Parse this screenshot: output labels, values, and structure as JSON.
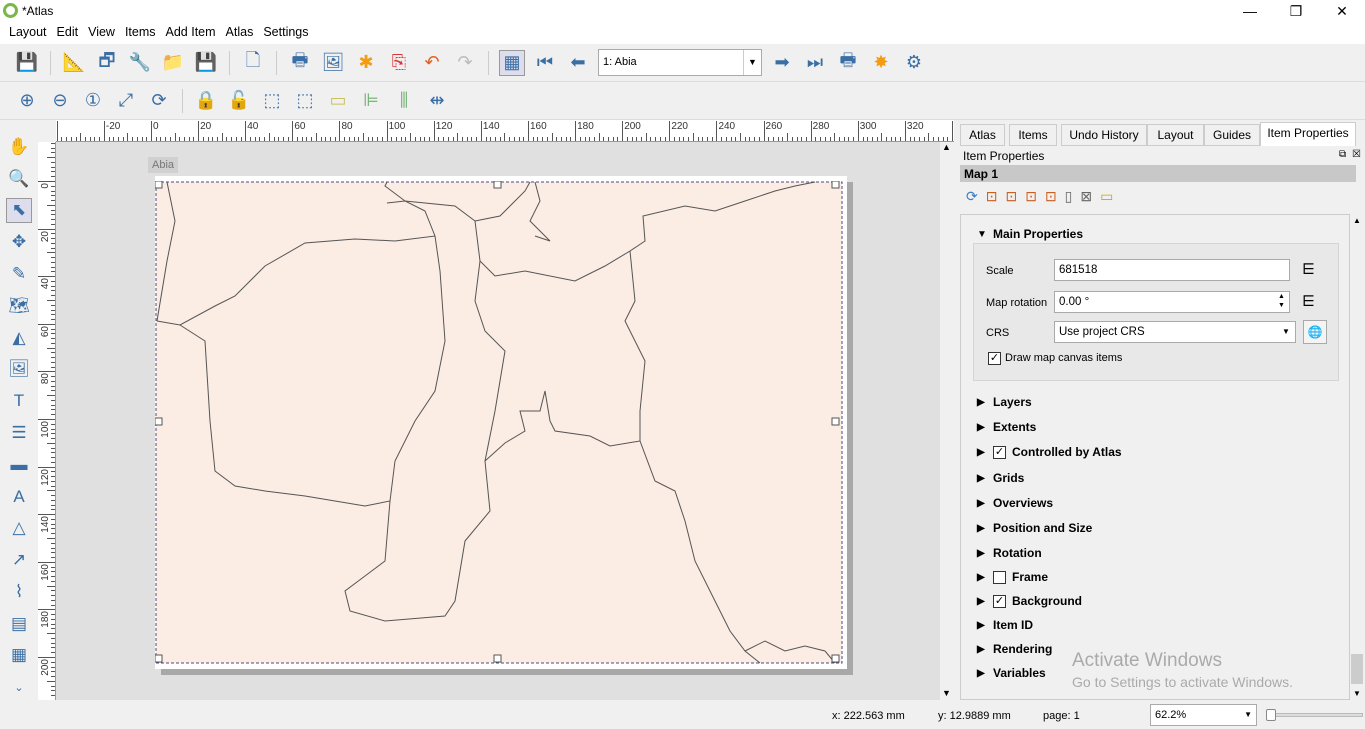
{
  "window": {
    "title": "*Atlas",
    "minimize": "—",
    "maximize": "❐",
    "close": "✕"
  },
  "menu": [
    "Layout",
    "Edit",
    "View",
    "Items",
    "Add Item",
    "Atlas",
    "Settings"
  ],
  "toolbar": {
    "atlas_feature": "1: Abia"
  },
  "ruler": {
    "top_ticks": [
      "-20",
      "0",
      "20",
      "40",
      "60",
      "80",
      "100",
      "120",
      "140",
      "160",
      "180",
      "200",
      "220",
      "240",
      "260",
      "280",
      "300",
      "320"
    ],
    "left_ticks": [
      "0",
      "20",
      "40",
      "60",
      "80",
      "100",
      "120",
      "140",
      "160",
      "180",
      "200"
    ]
  },
  "page": {
    "label": "Abia",
    "fill": "#fbece4"
  },
  "panel": {
    "tabs": [
      "Atlas",
      "Items",
      "Undo History",
      "Layout",
      "Guides",
      "Item Properties"
    ],
    "header": "Item Properties",
    "item_name": "Map 1",
    "main_title": "Main Properties",
    "scale_label": "Scale",
    "scale_value": "681518",
    "rotation_label": "Map rotation",
    "rotation_value": "0.00 °",
    "crs_label": "CRS",
    "crs_value": "Use project CRS",
    "draw_canvas_items": "Draw map canvas items",
    "sections": [
      {
        "label": "Layers",
        "checkbox": null
      },
      {
        "label": "Extents",
        "checkbox": null
      },
      {
        "label": "Controlled by Atlas",
        "checkbox": true
      },
      {
        "label": "Grids",
        "checkbox": null
      },
      {
        "label": "Overviews",
        "checkbox": null
      },
      {
        "label": "Position and Size",
        "checkbox": null
      },
      {
        "label": "Rotation",
        "checkbox": null
      },
      {
        "label": "Frame",
        "checkbox": false
      },
      {
        "label": "Background",
        "checkbox": true
      },
      {
        "label": "Item ID",
        "checkbox": null
      },
      {
        "label": "Rendering",
        "checkbox": null
      },
      {
        "label": "Variables",
        "checkbox": null
      }
    ]
  },
  "watermark": {
    "line1": "Activate Windows",
    "line2": "Go to Settings to activate Windows."
  },
  "status": {
    "x": "x: 222.563 mm",
    "y": "y: 12.9889 mm",
    "page": "page: 1",
    "zoom": "62.2%"
  }
}
